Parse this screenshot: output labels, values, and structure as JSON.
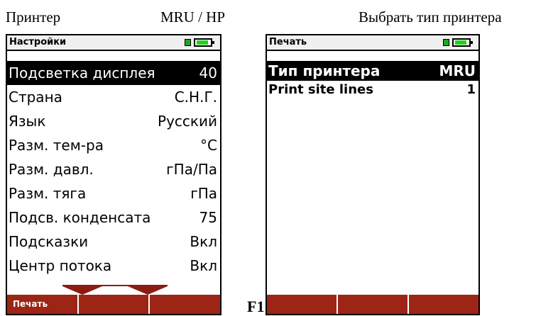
{
  "captions": {
    "left": "Принтер",
    "middle": "MRU / HP",
    "right": "Выбрать тип принтера",
    "footnote": "F1"
  },
  "left_screen": {
    "title": "Настройки",
    "items": [
      {
        "label": "Подсветка дисплея",
        "value": "40",
        "selected": true
      },
      {
        "label": "Страна",
        "value": "С.Н.Г."
      },
      {
        "label": "Язык",
        "value": "Русский"
      },
      {
        "label": "Разм. тем-ра",
        "value": "°C"
      },
      {
        "label": "Разм. давл.",
        "value": "гПа/Па"
      },
      {
        "label": "Разм. тяга",
        "value": "гПа"
      },
      {
        "label": "Подсв. конденсата",
        "value": "75"
      },
      {
        "label": "Подсказки",
        "value": "Вкл"
      },
      {
        "label": "Центр потока",
        "value": "Вкл"
      }
    ],
    "softkeys": [
      "Печать",
      "",
      ""
    ]
  },
  "right_screen": {
    "title": "Печать",
    "items": [
      {
        "label": "Тип принтера",
        "value": "MRU",
        "selected": true
      },
      {
        "label": "Print site lines",
        "value": "1"
      }
    ],
    "softkeys": [
      "",
      "",
      ""
    ]
  },
  "icons": {
    "status": [
      "plug-icon",
      "battery-icon"
    ],
    "scroll": [
      "scroll-down-icon"
    ]
  },
  "colors": {
    "softkey_bar": "#9c2516",
    "battery": "#1fd21f",
    "selection": "#000000"
  }
}
